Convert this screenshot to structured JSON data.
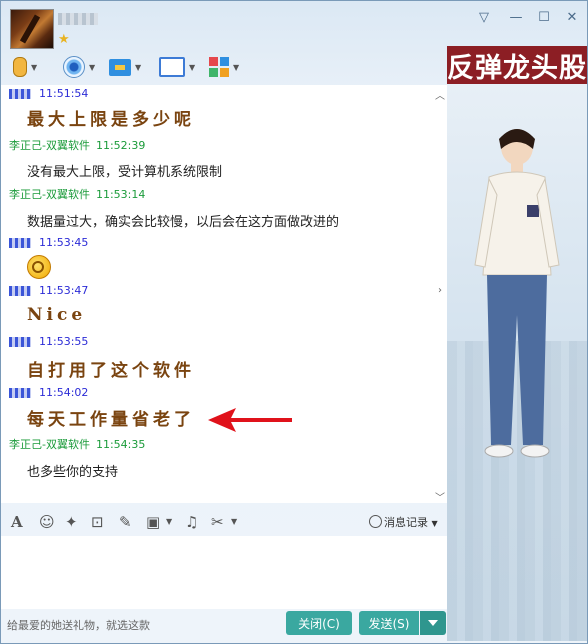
{
  "window": {
    "controls": {
      "skin": "▽",
      "minimize": "—",
      "maximize": "☐",
      "close": "✕"
    }
  },
  "toolbar": {
    "items": [
      {
        "icon": "microphone-icon"
      },
      {
        "icon": "webcam-icon"
      },
      {
        "icon": "file-transfer-icon"
      },
      {
        "icon": "remote-screen-icon"
      },
      {
        "icon": "apps-icon"
      }
    ]
  },
  "ad_banner": {
    "text": "反弹龙头股"
  },
  "messages": [
    {
      "sender": "",
      "time": "11:51:54",
      "text": "最大上限是多少呢",
      "style": "styled"
    },
    {
      "sender": "李正己-双翼软件",
      "time": "11:52:39",
      "text": "没有最大上限，受计算机系统限制",
      "style": "plain"
    },
    {
      "sender": "李正己-双翼软件",
      "time": "11:53:14",
      "text": "数据量过大，确实会比较慢，以后会在这方面做改进的",
      "style": "plain"
    },
    {
      "sender": "",
      "time": "11:53:45",
      "text": "",
      "style": "emoji"
    },
    {
      "sender": "",
      "time": "11:53:47",
      "text": "Nice",
      "style": "styled"
    },
    {
      "sender": "",
      "time": "11:53:55",
      "text": "自打用了这个软件",
      "style": "styled"
    },
    {
      "sender": "",
      "time": "11:54:02",
      "text": "每天工作量省老了",
      "style": "styled"
    },
    {
      "sender": "李正己-双翼软件",
      "time": "11:54:35",
      "text": "也多些你的支持",
      "style": "plain"
    }
  ],
  "input_toolbar": {
    "history_label": "消息记录"
  },
  "footer": {
    "gift_text": "给最爱的她送礼物，就选这款",
    "close_label": "关闭(C)",
    "send_label": "发送(S)"
  },
  "colors": {
    "ad_banner_bg": "#8c1e24",
    "button_teal": "#3aa8a0",
    "sender_self": "#2b2bd6",
    "sender_other": "#1b9b3a",
    "styled_text": "#7a4410",
    "arrow_red": "#e0121b"
  }
}
